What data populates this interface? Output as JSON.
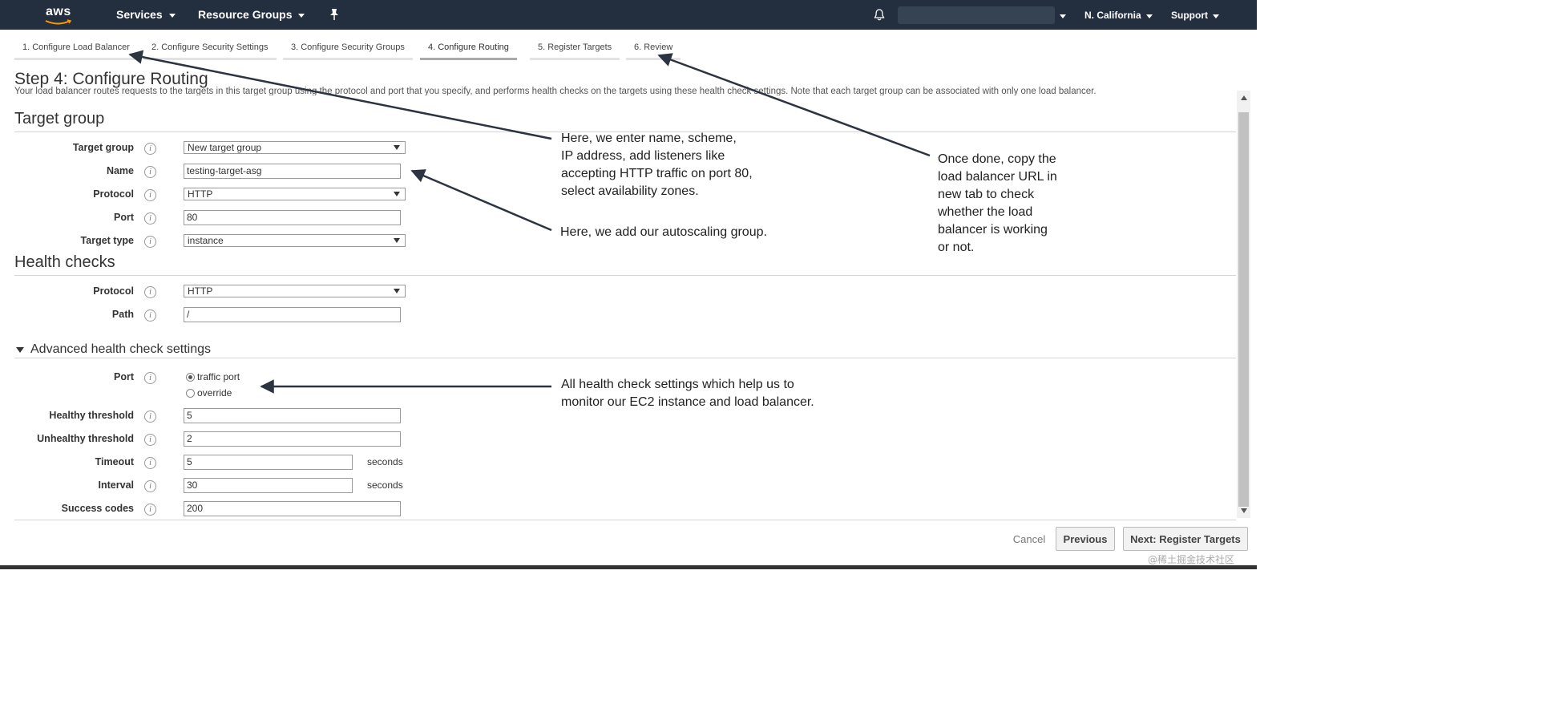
{
  "nav": {
    "logo_text": "aws",
    "services": "Services",
    "resource_groups": "Resource Groups",
    "region": "N. California",
    "support": "Support"
  },
  "wizard_tabs": [
    {
      "label": "1. Configure Load Balancer"
    },
    {
      "label": "2. Configure Security Settings"
    },
    {
      "label": "3. Configure Security Groups"
    },
    {
      "label": "4. Configure Routing",
      "active": true
    },
    {
      "label": "5. Register Targets"
    },
    {
      "label": "6. Review"
    }
  ],
  "page": {
    "title": "Step 4: Configure Routing",
    "description": "Your load balancer routes requests to the targets in this target group using the protocol and port that you specify, and performs health checks on the targets using these health check settings. Note that each target group can be associated with only one load balancer."
  },
  "target_group": {
    "heading": "Target group",
    "target_group_label": "Target group",
    "target_group_value": "New target group",
    "name_label": "Name",
    "name_value": "testing-target-asg",
    "protocol_label": "Protocol",
    "protocol_value": "HTTP",
    "port_label": "Port",
    "port_value": "80",
    "target_type_label": "Target type",
    "target_type_value": "instance"
  },
  "health_checks": {
    "heading": "Health checks",
    "protocol_label": "Protocol",
    "protocol_value": "HTTP",
    "path_label": "Path",
    "path_value": "/"
  },
  "advanced": {
    "heading": "Advanced health check settings",
    "port_label": "Port",
    "port_option_traffic": "traffic port",
    "port_option_override": "override",
    "healthy_label": "Healthy threshold",
    "healthy_value": "5",
    "unhealthy_label": "Unhealthy threshold",
    "unhealthy_value": "2",
    "timeout_label": "Timeout",
    "timeout_value": "5",
    "timeout_unit": "seconds",
    "interval_label": "Interval",
    "interval_value": "30",
    "interval_unit": "seconds",
    "success_label": "Success codes",
    "success_value": "200"
  },
  "footer": {
    "cancel": "Cancel",
    "previous": "Previous",
    "next": "Next: Register Targets"
  },
  "annotations": {
    "note1": [
      "Here, we enter name, scheme,",
      "IP address, add listeners like",
      "accepting HTTP traffic on port 80,",
      "select availability zones."
    ],
    "note2": "Here, we add our autoscaling group.",
    "note3": [
      "Once done, copy the",
      "load balancer URL in",
      "new tab to check",
      "whether the load",
      "balancer is working",
      "or not."
    ],
    "note4": [
      "All health check settings which help us to",
      "monitor our EC2 instance and load balancer."
    ]
  },
  "watermark": "@稀土掘金技术社区",
  "colors": {
    "nav_bg": "#232f3e",
    "nav_text": "#ffffff"
  }
}
